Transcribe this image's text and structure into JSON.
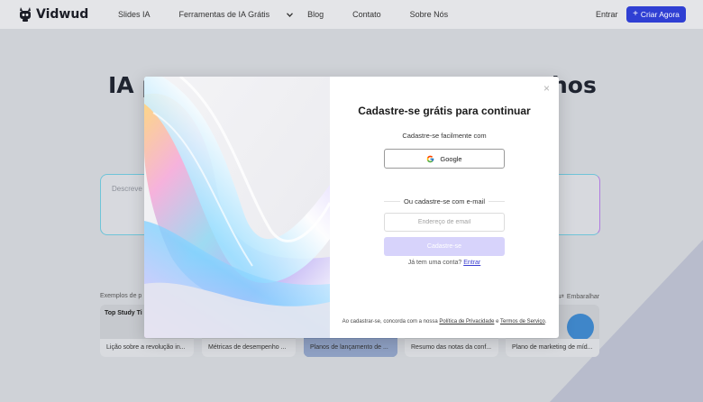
{
  "brand": {
    "name": "Vidwud"
  },
  "nav": {
    "items": [
      "Slides IA",
      "Ferramentas de IA Grátis",
      "Blog",
      "Contato",
      "Sobre Nós"
    ],
    "login": "Entrar",
    "cta": "Criar Agora"
  },
  "hero": {
    "heading_left": "IA p",
    "heading_right": "hos",
    "textarea_placeholder": "Descreve"
  },
  "examples": {
    "label": "Exemplos de p",
    "shuffle": "Embaralhar",
    "cards": [
      {
        "caption": "Lição sobre a revolução in...",
        "thumb_text": "Top Study Ti"
      },
      {
        "caption": "Métricas de desempenho ..."
      },
      {
        "caption": "Planos de lançamento de ..."
      },
      {
        "caption": "Resumo das notas da conf..."
      },
      {
        "caption": "Plano de marketing de míd..."
      }
    ]
  },
  "modal": {
    "close": "×",
    "title": "Cadastre-se grátis para continuar",
    "subtitle": "Cadastre-se facilmente com",
    "google_label": "Google",
    "divider": "Ou cadastre-se com e-mail",
    "email_placeholder": "Endereço de email",
    "signup_label": "Cadastre-se",
    "have_account": "Já tem uma conta?",
    "login_link": "Entrar",
    "terms_prefix": "Ao cadastrar-se, concorda com a nossa",
    "privacy_link": "Política de Privacidade",
    "and": "e",
    "terms_link": "Termos de Serviço",
    "terms_suffix": "."
  },
  "colors": {
    "accent": "#2f3fd3",
    "signup_disabled": "#d7d3fb",
    "link": "#3b3fd1"
  }
}
